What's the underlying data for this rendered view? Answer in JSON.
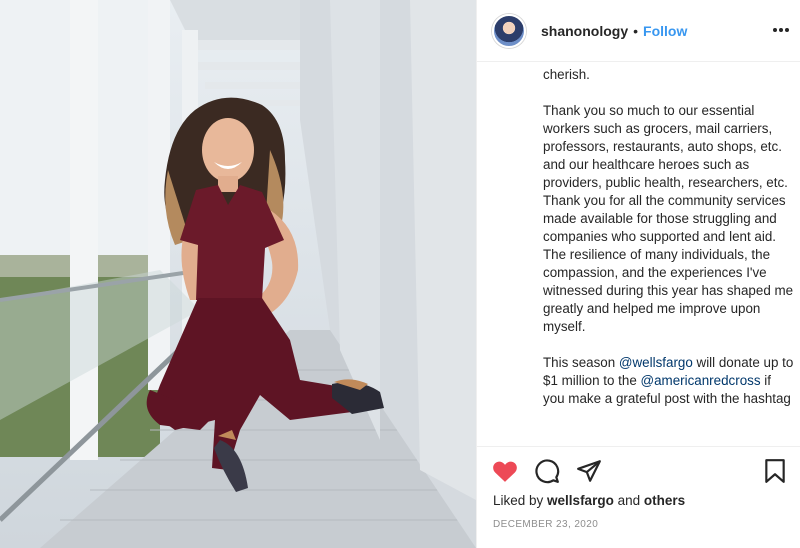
{
  "post": {
    "username": "shanonology",
    "dot": "•",
    "follow_label": "Follow",
    "caption": {
      "p1": "cherish.",
      "p2": "Thank you so much to our essential workers such as grocers, mail carriers, professors, restaurants, auto shops, etc. and our healthcare heroes such as providers, public health, researchers, etc. Thank you for all the community services made available for those struggling and companies who supported and lent aid. The resilience of many individuals, the compassion, and the experiences I've witnessed during this year has shaped me greatly and helped me improve upon myself.",
      "p3_a": "This season ",
      "p3_mention1": "@wellsfargo",
      "p3_b": " will donate up to $1 million to the ",
      "p3_mention2": "@americanredcross",
      "p3_c": " if you make a grateful post with the hashtag"
    },
    "likes": {
      "prefix": "Liked by ",
      "user": "wellsfargo",
      "middle": " and ",
      "others": "others"
    },
    "date": "December 23, 2020"
  },
  "icons": {
    "like": "heart-filled-icon",
    "comment": "comment-icon",
    "share": "share-icon",
    "save": "bookmark-icon",
    "more": "more-options-icon"
  },
  "colors": {
    "like": "#ed4956",
    "follow": "#3897f0",
    "mention": "#00376b",
    "scrubs": "#6b1a2a"
  }
}
